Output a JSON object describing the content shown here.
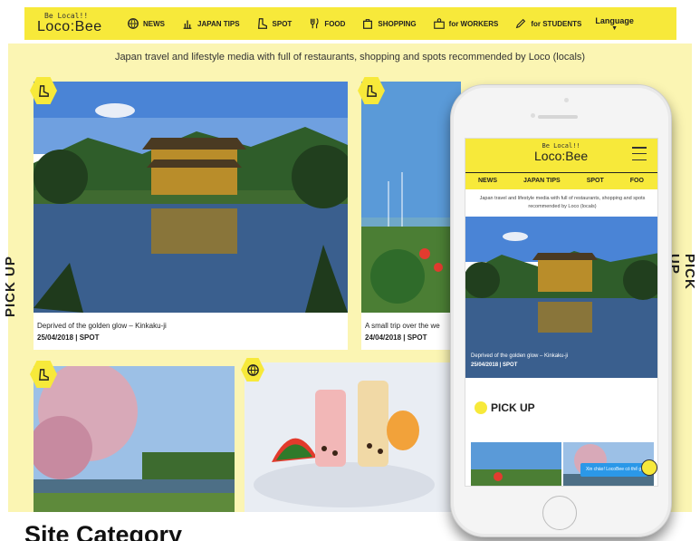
{
  "site": {
    "logo_tag": "Be Local!!",
    "logo_name": "Loco:Bee",
    "nav": [
      {
        "label": "NEWS",
        "icon": "globe-icon"
      },
      {
        "label": "JAPAN TIPS",
        "icon": "tips-icon"
      },
      {
        "label": "SPOT",
        "icon": "boot-icon"
      },
      {
        "label": "FOOD",
        "icon": "fork-icon"
      },
      {
        "label": "SHOPPING",
        "icon": "bag-icon"
      },
      {
        "label": "for WORKERS",
        "icon": "worker-icon"
      },
      {
        "label": "for STUDENTS",
        "icon": "pencil-icon"
      }
    ],
    "language_label": "Language",
    "tagline": "Japan travel and lifestyle media with full of restaurants, shopping and spots recommended by Loco (locals)",
    "pick_up_left": "PICK UP",
    "pick_up_right": "PICK UP"
  },
  "cards": [
    {
      "caption": "Deprived of the golden glow – Kinkaku-ji",
      "meta": "25/04/2018 | SPOT",
      "icon": "boot-icon"
    },
    {
      "caption": "A small trip over the we",
      "meta": "24/04/2018 | SPOT",
      "icon": "boot-icon"
    },
    {
      "caption": "",
      "meta": "",
      "icon": "boot-icon"
    },
    {
      "caption": "",
      "meta": "",
      "icon": "globe-icon"
    }
  ],
  "phone": {
    "logo_tag": "Be Local!!",
    "logo_name": "Loco:Bee",
    "tabs": [
      "NEWS",
      "JAPAN TIPS",
      "SPOT",
      "FOO"
    ],
    "tagline": "Japan travel and lifestyle media with full of restaurants, shopping and spots recommended by Loco (locals)",
    "hero_caption": "Deprived of the golden glow – Kinkaku-ji",
    "hero_meta": "25/04/2018 | SPOT",
    "pick_up": "PICK UP",
    "chat_text": "Xin chào! LocoBee có thể gi..."
  },
  "section_title": "Site Category",
  "colors": {
    "brand_yellow": "#f7e93a",
    "stage_bg": "#fbf5b3",
    "chat_blue": "#2b98e8"
  }
}
